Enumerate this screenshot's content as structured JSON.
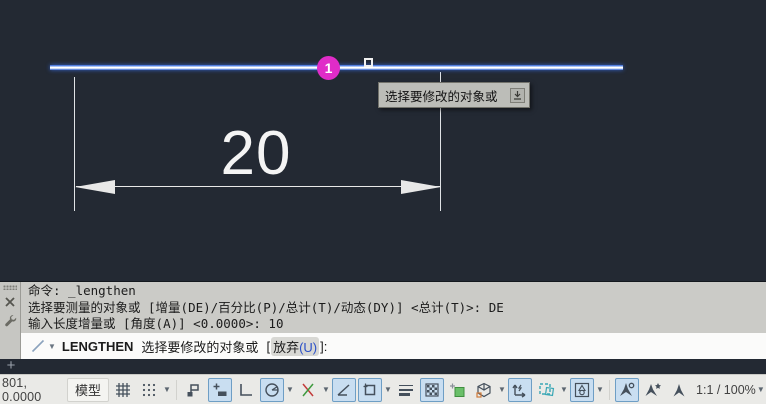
{
  "app": "AutoCAD",
  "canvas": {
    "dimension_value": "20",
    "badge_label": "1",
    "tooltip_text": "选择要修改的对象或",
    "line_color": "#2a5fd0",
    "badge_color": "#e02cc8",
    "geometry_color": "#e8e8e8",
    "background_color": "#232933"
  },
  "command": {
    "history": [
      "命令: _lengthen",
      "选择要测量的对象或 [增量(DE)/百分比(P)/总计(T)/动态(DY)] <总计(T)>: DE",
      "输入长度增量或 [角度(A)] <0.0000>: 10"
    ],
    "prompt": {
      "command": "LENGTHEN",
      "text": "选择要修改的对象或",
      "bracket_open": "[",
      "option_label": "放弃",
      "option_key": "(U)",
      "bracket_close": "]:"
    },
    "rail_icons": [
      "close-icon",
      "wrench-icon"
    ],
    "add_button": "+"
  },
  "statusbar": {
    "coordinates": "801, 0.0000",
    "model_label": "模型",
    "zoom_label": "1:1 / 100%",
    "active_color": "#c9def1",
    "icons": [
      {
        "name": "grid",
        "active": false
      },
      {
        "name": "snap",
        "active": false,
        "dropdown": true
      },
      {
        "name": "infer-constraints",
        "active": false
      },
      {
        "name": "dynamic-input",
        "active": true
      },
      {
        "name": "ortho",
        "active": false
      },
      {
        "name": "polar-tracking",
        "active": true,
        "dropdown": true
      },
      {
        "name": "isometric-drafting",
        "active": false,
        "dropdown": true
      },
      {
        "name": "object-snap-tracking",
        "active": true
      },
      {
        "name": "object-snap",
        "active": true,
        "dropdown": true
      },
      {
        "name": "lineweight",
        "active": false
      },
      {
        "name": "transparency",
        "active": true
      },
      {
        "name": "selection-cycling",
        "active": false
      },
      {
        "name": "dynamic-ucs",
        "active": false,
        "dropdown": true
      },
      {
        "name": "ucs",
        "active": true
      },
      {
        "name": "annotation-monitor",
        "active": false,
        "dropdown": true
      },
      {
        "name": "isolate-objects",
        "active": true,
        "dropdown": true
      },
      {
        "name": "annotation-visibility",
        "active": true
      },
      {
        "name": "annotation-autoscale",
        "active": false
      },
      {
        "name": "annotation-scale",
        "active": false
      }
    ]
  }
}
